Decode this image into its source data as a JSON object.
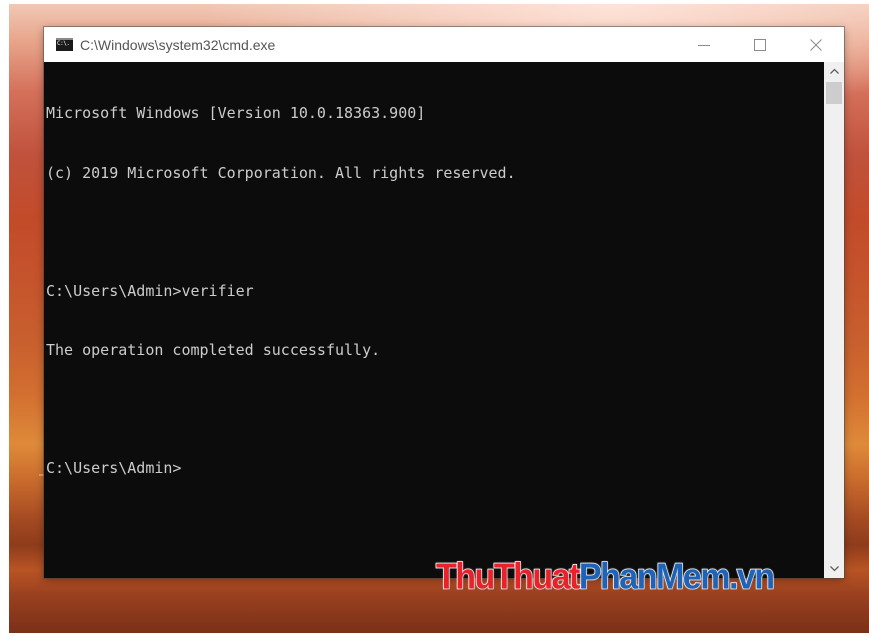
{
  "window": {
    "title": "C:\\Windows\\system32\\cmd.exe",
    "icon": "cmd-icon",
    "icon_glyph": "C:\\."
  },
  "caption_buttons": {
    "minimize_icon": "minimize-icon",
    "maximize_icon": "maximize-icon",
    "close_icon": "close-icon"
  },
  "console": {
    "lines": [
      "Microsoft Windows [Version 10.0.18363.900]",
      "(c) 2019 Microsoft Corporation. All rights reserved.",
      "",
      "C:\\Users\\Admin>verifier",
      "The operation completed successfully.",
      "",
      "C:\\Users\\Admin>"
    ]
  },
  "scrollbar": {
    "up_icon": "scroll-up-arrow-icon",
    "down_icon": "scroll-down-arrow-icon"
  },
  "watermark": {
    "part1": "Thu",
    "part2": "Thuat",
    "part3": "PhanMem",
    "part4": ".vn"
  },
  "colors": {
    "console_background": "#0c0c0c",
    "console_text": "#cccccc",
    "titlebar_background": "#ffffff",
    "watermark_red": "#e8212a",
    "watermark_blue": "#1f63b8"
  }
}
